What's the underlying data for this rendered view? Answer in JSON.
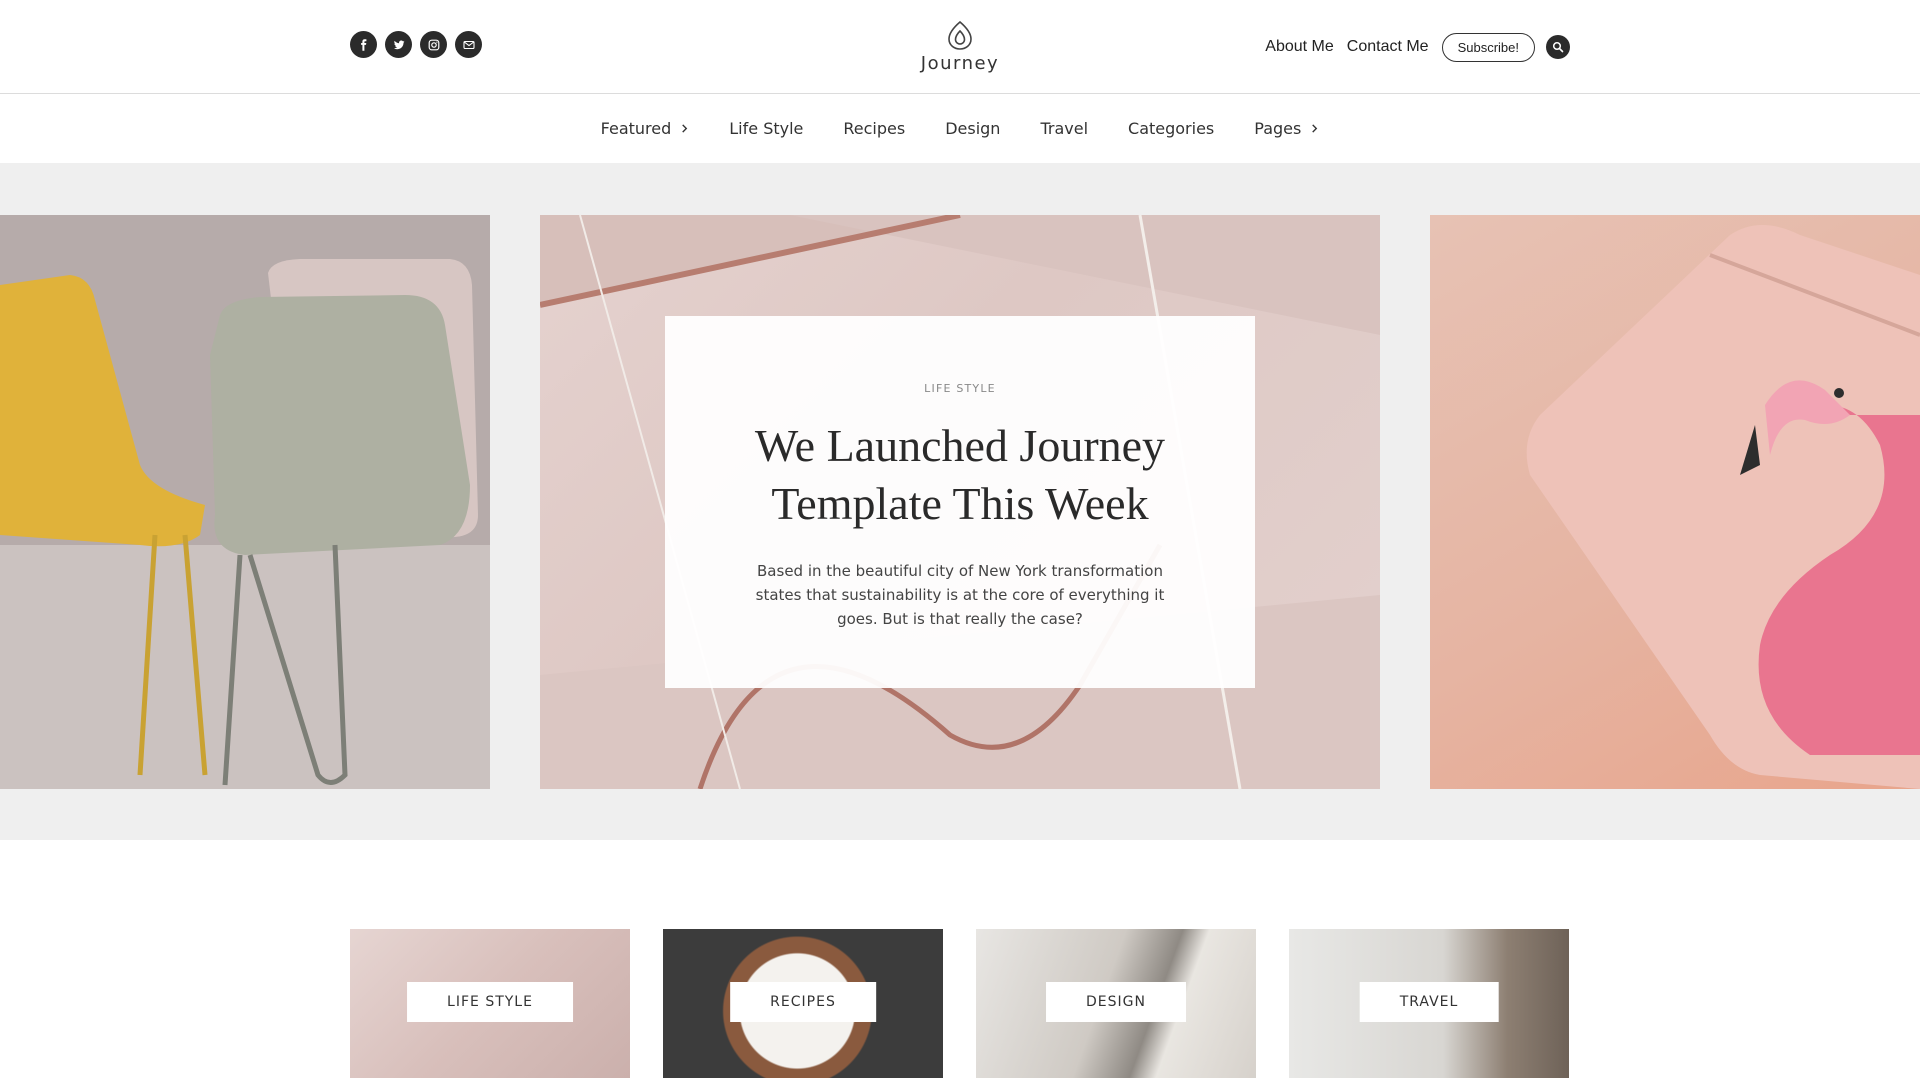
{
  "header": {
    "social_icons": [
      "facebook-icon",
      "twitter-icon",
      "instagram-icon",
      "email-icon"
    ],
    "logo_text": "Journey",
    "links": {
      "about": "About Me",
      "contact": "Contact Me"
    },
    "subscribe_label": "Subscribe!",
    "search_icon": "search-icon"
  },
  "nav": {
    "items": [
      {
        "label": "Featured",
        "has_chevron": true
      },
      {
        "label": "Life Style",
        "has_chevron": false
      },
      {
        "label": "Recipes",
        "has_chevron": false
      },
      {
        "label": "Design",
        "has_chevron": false
      },
      {
        "label": "Travel",
        "has_chevron": false
      },
      {
        "label": "Categories",
        "has_chevron": false
      },
      {
        "label": "Pages",
        "has_chevron": true
      }
    ]
  },
  "hero": {
    "category": "LIFE STYLE",
    "title": "We Launched Journey Template This Week",
    "excerpt": "Based in the beautiful city of New York transformation states that sustainability is at the core of everything it goes. But is that really the case?"
  },
  "categories": [
    {
      "label": "LIFE STYLE"
    },
    {
      "label": "RECIPES"
    },
    {
      "label": "DESIGN"
    },
    {
      "label": "TRAVEL"
    }
  ],
  "colors": {
    "dark": "#2b2b2b",
    "slider_bg": "#efefef",
    "border": "#dcdcdc"
  }
}
